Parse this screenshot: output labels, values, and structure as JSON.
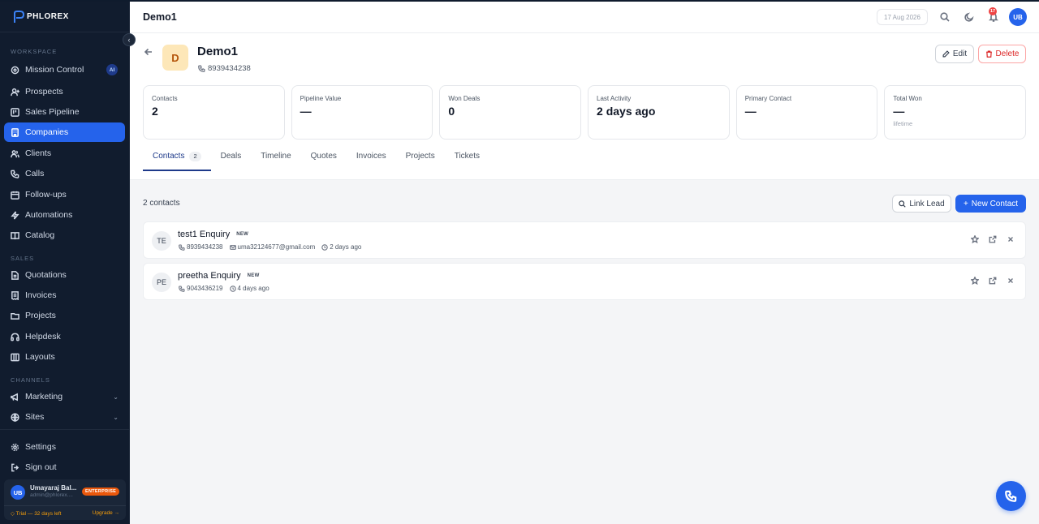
{
  "brand": {
    "logo_text": "PHLOREX"
  },
  "sidebar": {
    "sections": {
      "workspace": "WORKSPACE",
      "sales": "SALES",
      "channels": "CHANNELS"
    },
    "workspace_items": [
      {
        "label": "Mission Control",
        "icon": "target-icon",
        "badge": "AI"
      },
      {
        "label": "Prospects",
        "icon": "user-plus-icon"
      },
      {
        "label": "Sales Pipeline",
        "icon": "kanban-icon"
      },
      {
        "label": "Companies",
        "icon": "building-icon",
        "active": true
      },
      {
        "label": "Clients",
        "icon": "users-icon"
      },
      {
        "label": "Calls",
        "icon": "phone-icon"
      },
      {
        "label": "Follow-ups",
        "icon": "calendar-icon"
      },
      {
        "label": "Automations",
        "icon": "zap-icon"
      },
      {
        "label": "Catalog",
        "icon": "book-icon"
      }
    ],
    "sales_items": [
      {
        "label": "Quotations",
        "icon": "file-icon"
      },
      {
        "label": "Invoices",
        "icon": "receipt-icon"
      },
      {
        "label": "Projects",
        "icon": "folder-icon"
      },
      {
        "label": "Helpdesk",
        "icon": "headphones-icon"
      },
      {
        "label": "Layouts",
        "icon": "layout-icon"
      }
    ],
    "channel_items": [
      {
        "label": "Marketing",
        "icon": "megaphone-icon"
      },
      {
        "label": "Sites",
        "icon": "globe-icon"
      }
    ],
    "bottom_items": [
      {
        "label": "Settings",
        "icon": "gear-icon"
      },
      {
        "label": "Sign out",
        "icon": "logout-icon"
      }
    ],
    "user": {
      "initials": "UB",
      "name": "Umayaraj Bal...",
      "email": "admin@phlorex....",
      "plan": "ENTERPRISE",
      "trial": "◇ Trial — 32 days left",
      "upgrade": "Upgrade →"
    }
  },
  "topbar": {
    "title": "Demo1",
    "date": "17 Aug 2026",
    "notifications": "17",
    "avatar": "UB"
  },
  "company": {
    "initial": "D",
    "name": "Demo1",
    "phone": "8939434238",
    "edit_label": "Edit",
    "delete_label": "Delete"
  },
  "stats": [
    {
      "label": "Contacts",
      "value": "2",
      "sub": ""
    },
    {
      "label": "Pipeline Value",
      "value": "—",
      "sub": ""
    },
    {
      "label": "Won Deals",
      "value": "0",
      "sub": ""
    },
    {
      "label": "Last Activity",
      "value": "2 days ago",
      "sub": ""
    },
    {
      "label": "Primary Contact",
      "value": "—",
      "sub": ""
    },
    {
      "label": "Total Won",
      "value": "—",
      "sub": "lifetime"
    }
  ],
  "tabs": [
    {
      "label": "Contacts",
      "count": "2",
      "active": true
    },
    {
      "label": "Deals"
    },
    {
      "label": "Timeline"
    },
    {
      "label": "Quotes"
    },
    {
      "label": "Invoices"
    },
    {
      "label": "Projects"
    },
    {
      "label": "Tickets"
    }
  ],
  "contacts_panel": {
    "count_label": "2 contacts",
    "link_lead": "Link Lead",
    "new_contact": "New Contact"
  },
  "contacts": [
    {
      "initials": "TE",
      "name": "test1 Enquiry",
      "badge": "NEW",
      "phone": "8939434238",
      "email": "uma32124677@gmail.com",
      "time": "2 days ago"
    },
    {
      "initials": "PE",
      "name": "preetha Enquiry",
      "badge": "NEW",
      "phone": "9043436219",
      "email": "",
      "time": "4 days ago"
    }
  ],
  "colors": {
    "accent": "#2563eb",
    "sidebar_bg": "#111c2e",
    "danger": "#dc2626",
    "avatar_bg": "#fde7b8"
  }
}
